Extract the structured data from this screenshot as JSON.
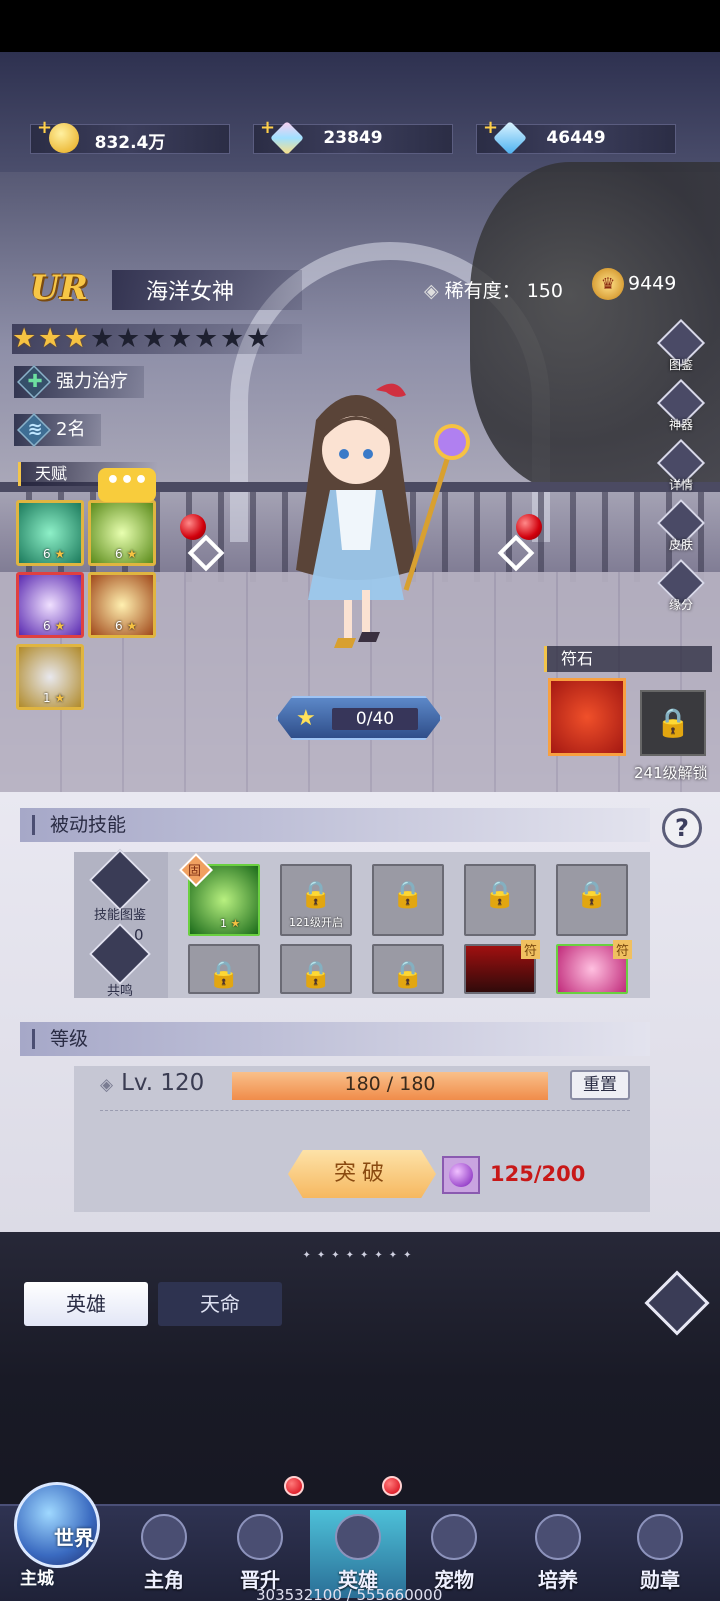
{
  "currencies": [
    {
      "name": "gold-coin",
      "value": "832.4万"
    },
    {
      "name": "rainbow-crystal",
      "value": "23849"
    },
    {
      "name": "blue-diamond",
      "value": "46449"
    }
  ],
  "hero": {
    "grade": "UR",
    "name": "海洋女神",
    "rarity_label": "稀有度：",
    "rarity_value": "150",
    "power": "9449",
    "stars_total": 10,
    "stars_filled": 3,
    "role": "强力治疗",
    "rank": "2名"
  },
  "talent": {
    "title": "天赋",
    "slots": [
      {
        "icon": "green-clover-icon",
        "level": "6"
      },
      {
        "icon": "green-cross-icon",
        "level": "6"
      },
      {
        "icon": "purple-swirl-icon",
        "level": "6"
      },
      {
        "icon": "golden-aura-icon",
        "level": "6"
      },
      {
        "icon": "silver-teapot-icon",
        "level": "1"
      }
    ]
  },
  "promote_progress": "0/40",
  "fushi": {
    "title": "符石",
    "unlock_text": "241级解锁"
  },
  "side_menu": [
    "图鉴",
    "神器",
    "详情",
    "皮肤",
    "缘分"
  ],
  "passive": {
    "title": "被动技能",
    "left_buttons": [
      {
        "label": "技能图鉴"
      },
      {
        "label": "共鸣",
        "count": "0"
      }
    ],
    "slots_row1": [
      {
        "type": "skill",
        "badge": "固",
        "level": "1"
      },
      {
        "type": "locked",
        "caption": "121级开启"
      },
      {
        "type": "locked"
      },
      {
        "type": "locked"
      },
      {
        "type": "locked"
      }
    ],
    "slots_row2": [
      {
        "type": "locked"
      },
      {
        "type": "locked"
      },
      {
        "type": "locked"
      },
      {
        "type": "portrait",
        "badge": "符"
      },
      {
        "type": "portrait",
        "badge": "符"
      }
    ]
  },
  "level": {
    "title": "等级",
    "current": "Lv. 120",
    "exp": "180 / 180",
    "reset_label": "重置",
    "break_label": "突破",
    "break_cost": "125/200"
  },
  "tabs": {
    "active": "英雄",
    "inactive": "天命"
  },
  "nav": {
    "world_top": "世界",
    "world_bottom": "主城",
    "items": [
      "主角",
      "晋升",
      "英雄",
      "宠物",
      "培养",
      "勋章"
    ],
    "active": "英雄"
  },
  "footer_value": "303532100 / 555660000"
}
